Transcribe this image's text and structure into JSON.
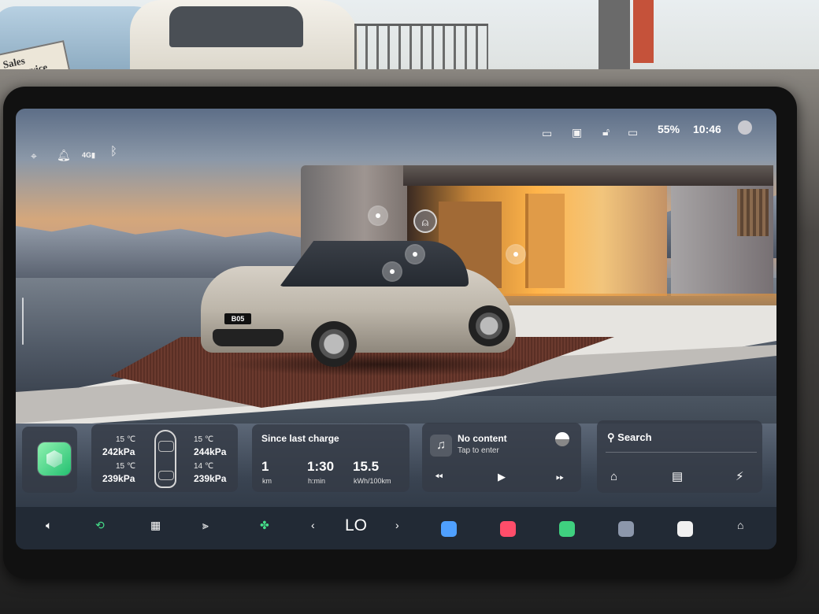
{
  "showroom_sign": {
    "line1": "Sales",
    "line2": "& Service"
  },
  "status_bar": {
    "icons_left": [
      "location-icon",
      "bell-icon",
      "signal-icon",
      "bluetooth-icon"
    ],
    "network_label": "4G",
    "icons_right": [
      "dashcam-icon",
      "phone-key-icon",
      "unlock-icon",
      "battery-icon"
    ],
    "battery_percent": "55%",
    "time": "10:46"
  },
  "vehicle": {
    "badge": "B05"
  },
  "tire_pressure": {
    "front_left": {
      "temp": "15 ℃",
      "pressure": "242kPa"
    },
    "front_right": {
      "temp": "15 ℃",
      "pressure": "244kPa"
    },
    "rear_left": {
      "temp": "15 ℃",
      "pressure": "239kPa"
    },
    "rear_right": {
      "temp": "14 ℃",
      "pressure": "239kPa"
    }
  },
  "since_last_charge": {
    "title": "Since last charge",
    "distance": {
      "value": "1",
      "unit": "km"
    },
    "duration": {
      "value": "1:30",
      "unit": "h:min"
    },
    "consumption": {
      "value": "15.5",
      "unit": "kWh/100km"
    }
  },
  "media": {
    "title": "No content",
    "subtitle": "Tap to enter",
    "controls": [
      "previous-icon",
      "play-icon",
      "next-icon"
    ]
  },
  "search": {
    "label": "Search",
    "quick_actions": [
      "home-icon",
      "work-briefcase-icon",
      "charging-bolt-icon"
    ]
  },
  "dock": {
    "climate_temp": "LO",
    "left_controls": [
      "volume-icon",
      "recirculation-icon",
      "rear-defrost-icon",
      "seat-heat-icon",
      "fan-icon"
    ],
    "apps": [
      "messages-app-icon",
      "music-app-icon",
      "maps-app-icon",
      "settings-app-icon",
      "app-launcher-icon",
      "home-icon"
    ],
    "app_colors": [
      "#4fa0ff",
      "#ff4d6a",
      "#3fd07f",
      "#8c97ab",
      "#f0f0f0",
      "#ffffff"
    ]
  }
}
